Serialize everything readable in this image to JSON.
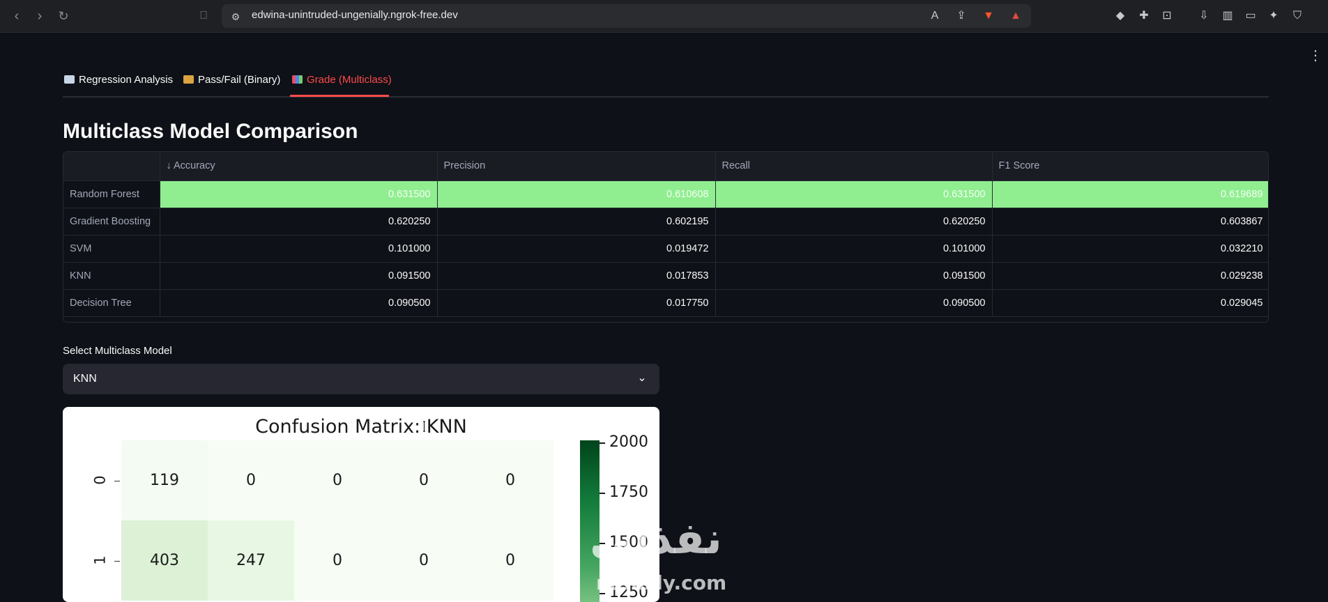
{
  "browser": {
    "url": "edwina-unintruded-ungenially.ngrok-free.dev"
  },
  "tabs": [
    {
      "label": "Regression Analysis",
      "icon": "chart-icon"
    },
    {
      "label": "Pass/Fail (Binary)",
      "icon": "scales-icon"
    },
    {
      "label": "Grade (Multiclass)",
      "icon": "bar-chart-icon",
      "active": true
    }
  ],
  "comparison": {
    "title": "Multiclass Model Comparison",
    "columns": [
      "",
      "↓ Accuracy",
      "Precision",
      "Recall",
      "F1 Score"
    ],
    "rows": [
      {
        "model": "Random Forest",
        "accuracy": "0.631500",
        "precision": "0.610608",
        "recall": "0.631500",
        "f1": "0.619689",
        "highlight": true
      },
      {
        "model": "Gradient Boosting",
        "accuracy": "0.620250",
        "precision": "0.602195",
        "recall": "0.620250",
        "f1": "0.603867"
      },
      {
        "model": "SVM",
        "accuracy": "0.101000",
        "precision": "0.019472",
        "recall": "0.101000",
        "f1": "0.032210"
      },
      {
        "model": "KNN",
        "accuracy": "0.091500",
        "precision": "0.017853",
        "recall": "0.091500",
        "f1": "0.029238"
      },
      {
        "model": "Decision Tree",
        "accuracy": "0.090500",
        "precision": "0.017750",
        "recall": "0.090500",
        "f1": "0.029045"
      }
    ],
    "highlight_color": "#90ee90"
  },
  "model_select": {
    "label": "Select Multiclass Model",
    "value": "KNN"
  },
  "chart_data": {
    "type": "heatmap",
    "title": "Confusion Matrix: KNN",
    "row_labels": [
      "0",
      "1"
    ],
    "matrix": [
      [
        "119",
        "0",
        "0",
        "0",
        "0"
      ],
      [
        "403",
        "247",
        "0",
        "0",
        "0"
      ]
    ],
    "colorbar_ticks": [
      "2000",
      "1750",
      "1500",
      "1250"
    ],
    "colormap": "Greens"
  },
  "watermark": {
    "arabic": "نفذلي",
    "latin": "nafazly.com"
  }
}
